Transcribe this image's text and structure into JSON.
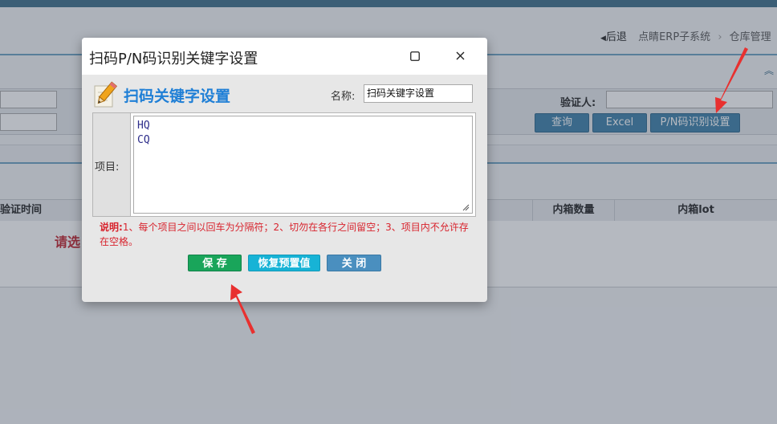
{
  "breadcrumb": {
    "back_label": "后退",
    "items": [
      "点睛ERP子系统",
      "仓库管理"
    ]
  },
  "filter": {
    "verifier_label": "验证人:",
    "verifier_value": "",
    "buttons": {
      "query": "查询",
      "excel": "Excel",
      "pn_setting": "P/N码识别设置"
    }
  },
  "table": {
    "columns": [
      "验证时间",
      "内箱数量",
      "内箱lot"
    ],
    "empty_hint": "请选"
  },
  "dialog": {
    "title": "扫码P/N码识别关键字设置",
    "maximize_glyph": "☐",
    "close_glyph": "×",
    "heading": "扫码关键字设置",
    "name_label": "名称:",
    "name_value": "扫码关键字设置",
    "item_label": "项目:",
    "items_text": "HQ\nCQ",
    "note_prefix": "说明:",
    "note_text": "1、每个项目之间以回车为分隔符；2、切勿在各行之间留空；3、项目内不允许存在空格。",
    "buttons": {
      "save": "保 存",
      "restore": "恢复预置值",
      "close": "关 闭"
    }
  },
  "colors": {
    "accent": "#3a7fa8",
    "heading_blue": "#1f7fd6",
    "note_red": "#d8242e",
    "save_green": "#19a55a",
    "restore_cyan": "#17b3d6",
    "close_blue": "#4a8fbf",
    "annotation_red": "#e8302f"
  }
}
